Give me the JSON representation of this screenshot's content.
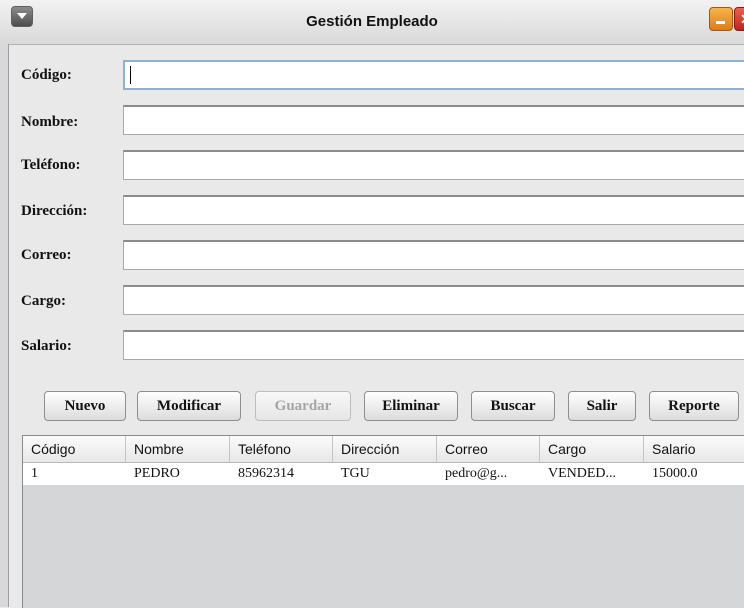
{
  "window": {
    "title": "Gestión Empleado",
    "close_glyph": "✕"
  },
  "form": {
    "codigo_label": "Código:",
    "nombre_label": "Nombre:",
    "telefono_label": "Teléfono:",
    "direccion_label": "Dirección:",
    "correo_label": "Correo:",
    "cargo_label": "Cargo:",
    "salario_label": "Salario:"
  },
  "buttons": {
    "nuevo": "Nuevo",
    "modificar": "Modificar",
    "guardar": "Guardar",
    "eliminar": "Eliminar",
    "buscar": "Buscar",
    "salir": "Salir",
    "reporte": "Reporte"
  },
  "table": {
    "columns": [
      "Código",
      "Nombre",
      "Teléfono",
      "Dirección",
      "Correo",
      "Cargo",
      "Salario"
    ],
    "rows": [
      [
        "1",
        "PEDRO",
        "85962314",
        "TGU",
        "pedro@g...",
        "VENDED...",
        "15000.0"
      ]
    ]
  }
}
